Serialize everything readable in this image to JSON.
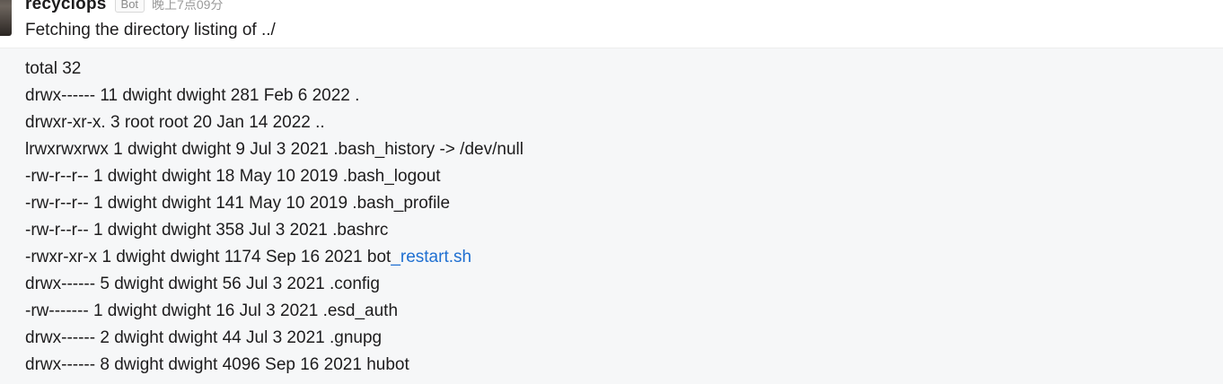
{
  "message": {
    "username": "recyclops",
    "badge": "Bot",
    "timestamp": "晚上7点09分",
    "text": "Fetching the directory listing of ../"
  },
  "listing": {
    "lines": [
      "total 32",
      "drwx------ 11 dwight dwight 281 Feb 6 2022 .",
      "drwxr-xr-x. 3 root root 20 Jan 14 2022 ..",
      "lrwxrwxrwx 1 dwight dwight 9 Jul 3 2021 .bash_history -> /dev/null",
      "-rw-r--r-- 1 dwight dwight 18 May 10 2019 .bash_logout",
      "-rw-r--r-- 1 dwight dwight 141 May 10 2019 .bash_profile",
      "-rw-r--r-- 1 dwight dwight 358 Jul 3 2021 .bashrc"
    ],
    "link_line": {
      "prefix": "-rwxr-xr-x 1 dwight dwight 1174 Sep 16 2021 bot",
      "link_text": "_restart.sh"
    },
    "lines_after": [
      "drwx------ 5 dwight dwight 56 Jul 3 2021 .config",
      "-rw------- 1 dwight dwight 16 Jul 3 2021 .esd_auth",
      "drwx------ 2 dwight dwight 44 Jul 3 2021 .gnupg",
      "drwx------ 8 dwight dwight 4096 Sep 16 2021 hubot"
    ]
  }
}
